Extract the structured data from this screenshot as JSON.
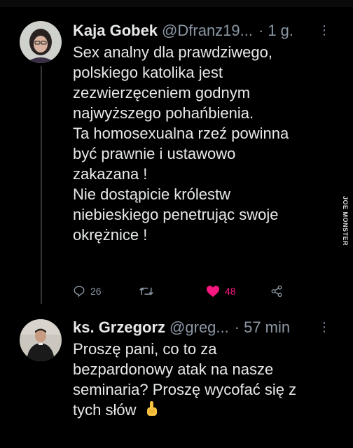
{
  "tweets": [
    {
      "name": "Kaja Gobek",
      "handle": "@Dfranz19...",
      "time": "1 g.",
      "lines": [
        "Sex analny dla prawdziwego,",
        "polskiego katolika jest",
        "zezwierzęceniem godnym",
        "najwyższego pohańbienia.",
        "Ta homosexualna rzeź powinna",
        "być prawnie i ustawowo",
        "zakazana !",
        "Nie dostąpicie królestw",
        "niebieskiego penetrując swoje",
        "okrężnice !"
      ],
      "replies": "26",
      "retweets": "",
      "likes": "48",
      "liked": true
    },
    {
      "name": "ks. Grzegorz",
      "handle": "@greg...",
      "time": "57 min",
      "lines": [
        "Proszę pani, co to za",
        "bezpardonowy atak na nasze",
        "seminaria? Proszę wycofać się z",
        "tych słów"
      ],
      "emoji_icon": "pointing-up-hand-icon"
    }
  ],
  "watermark": "JOE MONSTER",
  "colors": {
    "background": "#000000",
    "text": "#e7e9ea",
    "muted": "#8b98a5",
    "like": "#f91880"
  }
}
